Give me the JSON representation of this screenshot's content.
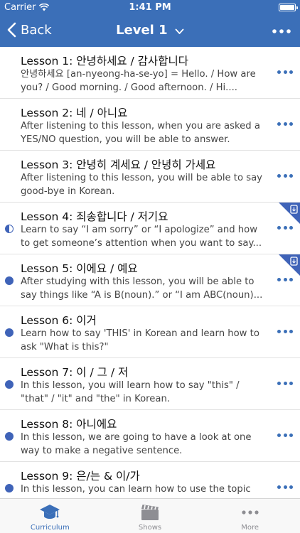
{
  "status_bar": {
    "carrier": "Carrier",
    "time": "1:41 PM"
  },
  "nav": {
    "back_label": "Back",
    "title": "Level 1"
  },
  "colors": {
    "accent": "#3b6fb8",
    "status": "#3f63b8"
  },
  "lessons": [
    {
      "title": "Lesson 1: 안녕하세요 / 감사합니다",
      "desc": "안녕하세요 [an-nyeong-ha-se-yo] = Hello. / How are you? / Good morning. / Good afternoon. / Hi....",
      "status": "none",
      "downloaded": false
    },
    {
      "title": "Lesson 2: 네 / 아니요",
      "desc": "After listening to this lesson, when you are asked a YES/NO question, you will be able to answer.",
      "status": "none",
      "downloaded": false
    },
    {
      "title": "Lesson 3: 안녕히 계세요 / 안녕히 가세요",
      "desc": "After listening to this lesson, you will be able to say good-bye in Korean.",
      "status": "none",
      "downloaded": false
    },
    {
      "title": "Lesson 4: 죄송합니다 / 저기요",
      "desc": "Learn to say “I am sorry” or “I apologize” and how to get someone’s attention when you want to say...",
      "status": "half",
      "downloaded": true
    },
    {
      "title": "Lesson 5: 이에요 / 예요",
      "desc": "After studying with this lesson, you will be able to say things like “A is B(noun).” or “I am ABC(noun)...",
      "status": "full",
      "downloaded": true
    },
    {
      "title": "Lesson 6: 이거",
      "desc": "Learn how to say 'THIS' in Korean and learn how to ask \"What is this?\"",
      "status": "full",
      "downloaded": false
    },
    {
      "title": "Lesson 7: 이 / 그 / 저",
      "desc": "In this lesson, you will learn how to say \"this\" / \"that\" / \"it\" and \"the\" in Korean.",
      "status": "full",
      "downloaded": false
    },
    {
      "title": "Lesson 8: 아니에요",
      "desc": "In this lesson, we are going to have a look at one way to make a negative sentence.",
      "status": "full",
      "downloaded": false
    },
    {
      "title": "Lesson 9: 은/는 & 이/가",
      "desc": "In this lesson, you can learn how to use the topic",
      "status": "full",
      "downloaded": false
    }
  ],
  "tabs": [
    {
      "label": "Curriculum",
      "icon": "graduation-cap-icon",
      "active": true
    },
    {
      "label": "Shows",
      "icon": "clapperboard-icon",
      "active": false
    },
    {
      "label": "More",
      "icon": "more-dots-icon",
      "active": false
    }
  ]
}
